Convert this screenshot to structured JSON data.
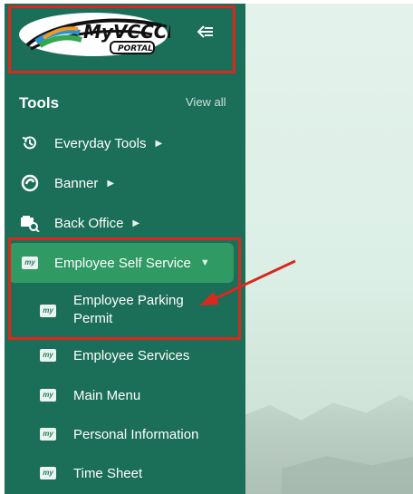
{
  "sidebar": {
    "logo_alt": "MyVCCCD PORTAL",
    "collapse_label": "⇇",
    "tools_title": "Tools",
    "view_all": "View all",
    "items": [
      {
        "label": "Everyday Tools",
        "icon": "history-icon",
        "has_caret": true
      },
      {
        "label": "Banner",
        "icon": "banner-icon",
        "has_caret": true
      },
      {
        "label": "Back Office",
        "icon": "back-office-icon",
        "has_caret": true
      },
      {
        "label": "Employee Self Service",
        "icon": "my-icon",
        "has_caret": true,
        "expanded": true
      }
    ],
    "subitems": [
      {
        "label": "Employee Parking Permit",
        "icon": "my-icon"
      },
      {
        "label": "Employee Services",
        "icon": "my-icon"
      },
      {
        "label": "Main Menu",
        "icon": "my-icon"
      },
      {
        "label": "Personal Information",
        "icon": "my-icon"
      },
      {
        "label": "Time Sheet",
        "icon": "my-icon"
      }
    ],
    "badge_text": "my"
  },
  "colors": {
    "sidebar_bg": "#1b6e57",
    "active_bg": "#2f9a64",
    "annotation_red": "#d9291e",
    "content_bg": "#dcefe6"
  }
}
